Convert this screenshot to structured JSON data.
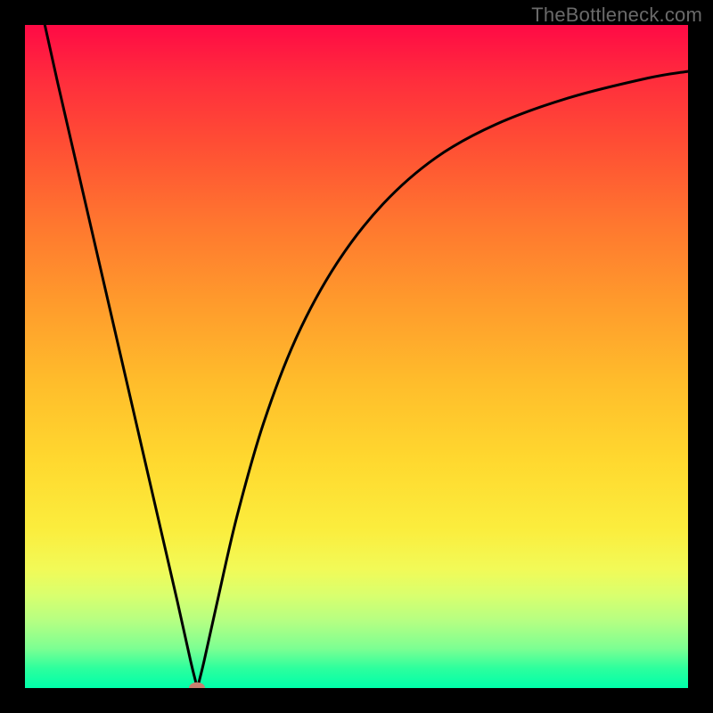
{
  "watermark": "TheBottleneck.com",
  "chart_data": {
    "type": "line",
    "title": "",
    "xlabel": "",
    "ylabel": "",
    "xlim": [
      0,
      100
    ],
    "ylim": [
      0,
      100
    ],
    "marker": {
      "x": 26,
      "y": 0,
      "color": "#c98070"
    },
    "series": [
      {
        "name": "curve",
        "color": "#000000",
        "x": [
          3,
          5,
          8,
          11,
          14,
          17,
          20,
          23,
          25,
          26,
          27,
          29,
          32,
          36,
          41,
          47,
          54,
          62,
          71,
          82,
          94,
          100
        ],
        "values": [
          100,
          91,
          78,
          65,
          52,
          39,
          26,
          13,
          4,
          0,
          4,
          13,
          26,
          40,
          53,
          64,
          73,
          80,
          85,
          89,
          92,
          93
        ]
      }
    ],
    "gradient": {
      "top": "#ff0a45",
      "bottom": "#00ffaa"
    }
  }
}
